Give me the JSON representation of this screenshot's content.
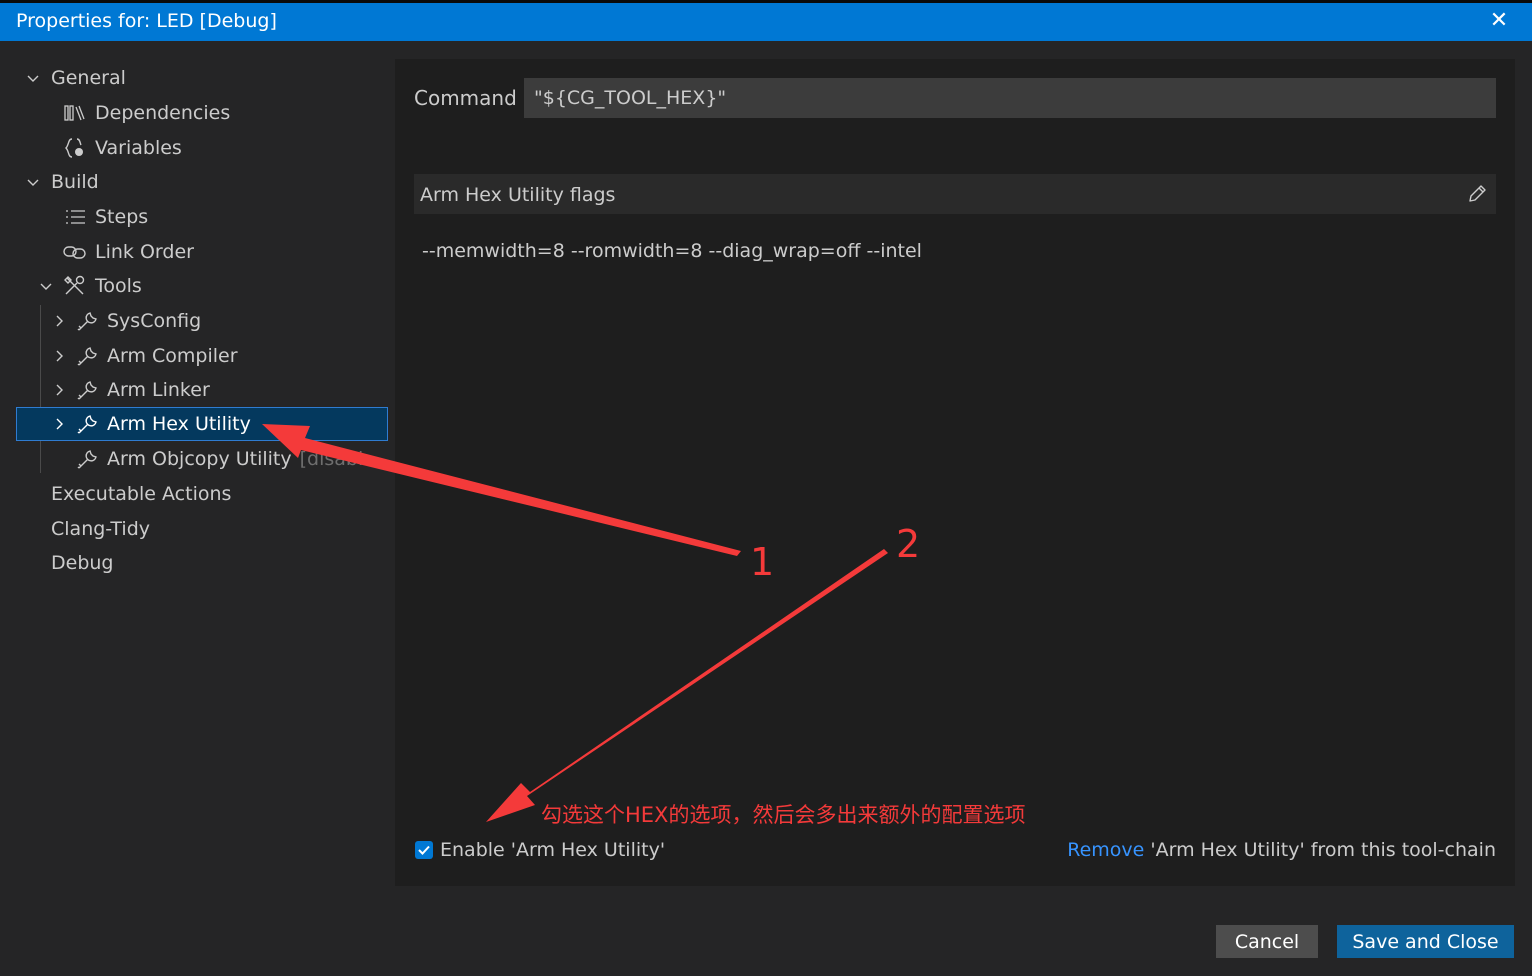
{
  "window": {
    "title": "Properties for: LED [Debug]"
  },
  "sidebar": {
    "items": [
      {
        "label": "General",
        "icon": ""
      },
      {
        "label": "Dependencies",
        "icon": "library-icon"
      },
      {
        "label": "Variables",
        "icon": "variable-braces-icon"
      },
      {
        "label": "Build",
        "icon": ""
      },
      {
        "label": "Steps",
        "icon": "list-icon"
      },
      {
        "label": "Link Order",
        "icon": "link-icon"
      },
      {
        "label": "Tools",
        "icon": "tools-icon"
      },
      {
        "label": "SysConfig",
        "icon": "wrench-icon"
      },
      {
        "label": "Arm Compiler",
        "icon": "wrench-icon"
      },
      {
        "label": "Arm Linker",
        "icon": "wrench-icon"
      },
      {
        "label": "Arm Hex Utility",
        "icon": "wrench-icon"
      },
      {
        "label": "Arm Objcopy Utility",
        "icon": "wrench-icon",
        "suffix": "[disabl..."
      },
      {
        "label": "Executable Actions",
        "icon": ""
      },
      {
        "label": "Clang-Tidy",
        "icon": ""
      },
      {
        "label": "Debug",
        "icon": ""
      }
    ],
    "selected": "Arm Hex Utility"
  },
  "main": {
    "command_label": "Command",
    "command_value": "\"${CG_TOOL_HEX}\"",
    "flags_title": "Arm Hex Utility flags",
    "flags_value": "--memwidth=8 --romwidth=8 --diag_wrap=off --intel",
    "enable_label": "Enable 'Arm Hex Utility'",
    "enable_checked": true,
    "remove_link": "Remove",
    "remove_text": " 'Arm Hex Utility' from this tool-chain"
  },
  "footer": {
    "cancel_label": "Cancel",
    "save_label": "Save and Close"
  },
  "annotations": {
    "label_1": "1",
    "label_2": "2",
    "note": "勾选这个HEX的选项，然后会多出来额外的配置选项",
    "color": "#f43a3a"
  },
  "colors": {
    "title_bar": "#0078d4",
    "selection": "#04395e",
    "link": "#3794ff",
    "primary_button": "#0e639c",
    "secondary_button": "#4d4d4d"
  }
}
